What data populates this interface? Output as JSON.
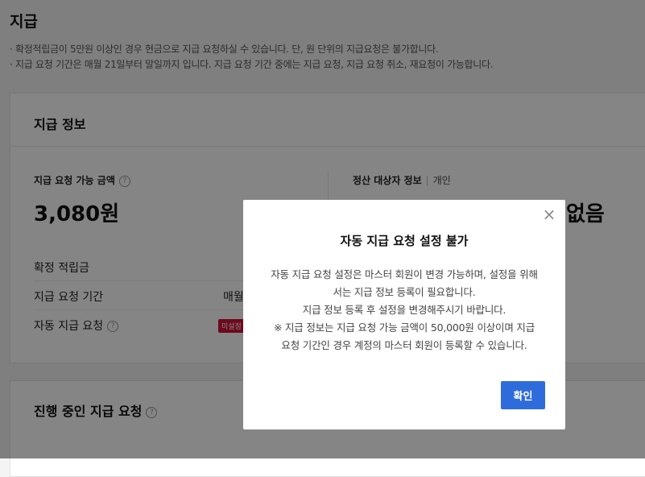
{
  "page": {
    "title": "지급",
    "notices": [
      "· 확정적립금이 5만원 이상인 경우 현금으로 지급 요청하실 수 있습니다. 단, 원 단위의 지급요청은 불가합니다.",
      "· 지급 요청 기간은 매월 21일부터 말일까지 입니다. 지급 요청 기간 중에는 지급 요청, 지급 요청 취소, 재요청이 가능합니다."
    ]
  },
  "payment_info": {
    "title": "지급 정보",
    "available_label": "지급 요청 가능 금액",
    "available_amount": "3,080원",
    "help_glyph": "?",
    "rows": [
      {
        "label": "확정 적립금",
        "value": ""
      },
      {
        "label": "지급 요청 기간",
        "value": "매월"
      },
      {
        "label": "자동 지급 요청",
        "badge": "미설정"
      }
    ],
    "settlement_label": "정산 대상자 정보",
    "settlement_value": "개인",
    "settlement_none": "없음"
  },
  "in_progress": {
    "title": "진행 중인 지급 요청"
  },
  "modal": {
    "close_glyph": "×",
    "title": "자동 지급 요청 설정 불가",
    "body_lines": [
      "자동 지급 요청 설정은 마스터 회원이 변경 가능하며, 설정을 위해",
      "서는 지급 정보 등록이 필요합니다.",
      "지급 정보 등록 후 설정을 변경해주시기 바랍니다.",
      "※ 지급 정보는 지급 요청 가능 금액이 50,000원 이상이며 지급",
      "요청 기간인 경우 계정의 마스터 회원이 등록할 수 있습니다."
    ],
    "confirm_label": "확인"
  },
  "colors": {
    "primary": "#2e6cdc",
    "badge": "#d2133a"
  }
}
